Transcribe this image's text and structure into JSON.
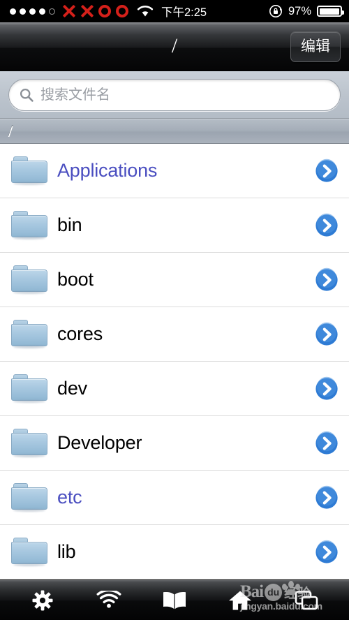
{
  "statusbar": {
    "signal_dots_total": 5,
    "signal_dots_filled": 4,
    "carrier_symbols": [
      "x-mark",
      "x-mark",
      "o-mark",
      "o-mark"
    ],
    "wifi_icon": "wifi-icon",
    "time": "下午2:25",
    "rotation_lock_icon": "rotation-lock-icon",
    "battery_percent": "97%",
    "battery_level": 97,
    "battery_icon": "battery-icon"
  },
  "navbar": {
    "title": "/",
    "edit_label": "编辑"
  },
  "search": {
    "icon": "search-icon",
    "value": "",
    "placeholder": "搜索文件名"
  },
  "section": {
    "label": "/"
  },
  "list": {
    "items": [
      {
        "name": "Applications",
        "type": "folder",
        "is_link": true,
        "icon": "folder-icon",
        "accessory": "disclosure-arrow-icon"
      },
      {
        "name": "bin",
        "type": "folder",
        "is_link": false,
        "icon": "folder-icon",
        "accessory": "disclosure-arrow-icon"
      },
      {
        "name": "boot",
        "type": "folder",
        "is_link": false,
        "icon": "folder-icon",
        "accessory": "disclosure-arrow-icon"
      },
      {
        "name": "cores",
        "type": "folder",
        "is_link": false,
        "icon": "folder-icon",
        "accessory": "disclosure-arrow-icon"
      },
      {
        "name": "dev",
        "type": "folder",
        "is_link": false,
        "icon": "folder-icon",
        "accessory": "disclosure-arrow-icon"
      },
      {
        "name": "Developer",
        "type": "folder",
        "is_link": false,
        "icon": "folder-icon",
        "accessory": "disclosure-arrow-icon"
      },
      {
        "name": "etc",
        "type": "folder",
        "is_link": true,
        "icon": "folder-icon",
        "accessory": "disclosure-arrow-icon"
      },
      {
        "name": "lib",
        "type": "folder",
        "is_link": false,
        "icon": "folder-icon",
        "accessory": "disclosure-arrow-icon"
      }
    ]
  },
  "toolbar": {
    "items": [
      {
        "icon": "gear-icon",
        "name": "settings"
      },
      {
        "icon": "wifi-icon",
        "name": "network"
      },
      {
        "icon": "book-icon",
        "name": "bookmarks"
      },
      {
        "icon": "home-icon",
        "name": "home"
      },
      {
        "icon": "tabs-icon",
        "name": "windows"
      }
    ]
  },
  "watermark": {
    "brand": "Bai",
    "badge": "du",
    "suffix": "经验",
    "url": "jingyan.baidu.com"
  },
  "colors": {
    "link_text": "#4a4ec0",
    "carrier_red": "#d4201a",
    "disclosure_blue": "#2e7bd4",
    "folder_blue": "#a8c8e0",
    "row_text": "#000000"
  }
}
